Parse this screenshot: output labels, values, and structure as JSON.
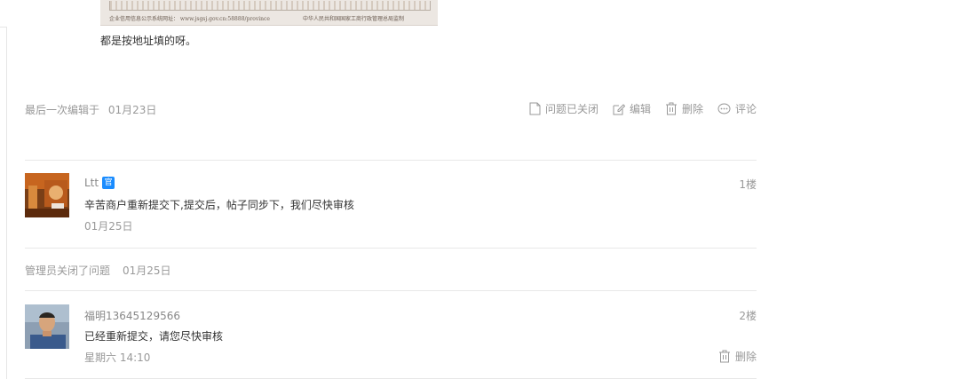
{
  "attachment": {
    "cert_left": "企业信用信息公示系统网址： www.jsgsj.gov.cn:58888/province",
    "cert_right": "中华人民共和国国家工商行政管理总局监制"
  },
  "reply_text": "都是按地址填的呀。",
  "meta": {
    "edited_label": "最后一次编辑于",
    "edited_date": "01月23日",
    "actions": {
      "closed": "问题已关闭",
      "edit": "编辑",
      "delete": "删除",
      "comment": "评论"
    }
  },
  "floors": [
    {
      "user": "Ltt",
      "badge": "官",
      "content": "辛苦商户重新提交下,提交后，帖子同步下，我们尽快审核",
      "date": "01月25日",
      "floor": "1楼"
    },
    {
      "user": "福明13645129566",
      "content": "已经重新提交，请您尽快审核",
      "date": "星期六 14:10",
      "floor": "2楼",
      "delete_label": "删除"
    }
  ],
  "closed_note": {
    "text": "管理员关闭了问题",
    "date": "01月25日"
  },
  "colors": {
    "badge": "#1a8cff",
    "muted": "#999999",
    "text": "#333333"
  }
}
